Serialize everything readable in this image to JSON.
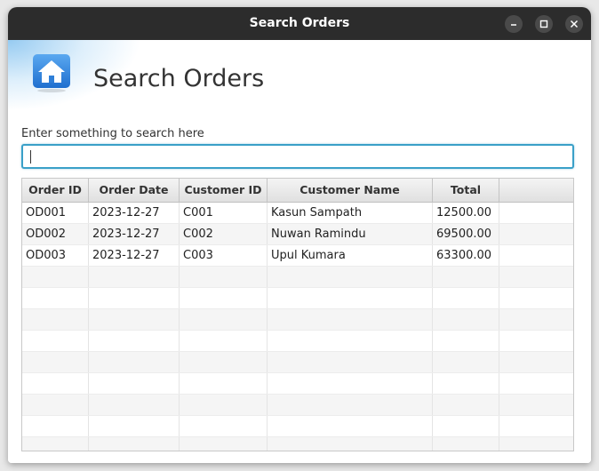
{
  "window": {
    "title": "Search Orders"
  },
  "header": {
    "title": "Search Orders",
    "icon": "home-icon"
  },
  "search": {
    "label": "Enter something to search here",
    "value": "",
    "placeholder": ""
  },
  "table": {
    "columns": [
      "Order ID",
      "Order Date",
      "Customer ID",
      "Customer Name",
      "Total",
      ""
    ],
    "rows": [
      [
        "OD001",
        "2023-12-27",
        "C001",
        "Kasun Sampath",
        "12500.00",
        ""
      ],
      [
        "OD002",
        "2023-12-27",
        "C002",
        "Nuwan Ramindu",
        "69500.00",
        ""
      ],
      [
        "OD003",
        "2023-12-27",
        "C003",
        "Upul Kumara",
        "63300.00",
        ""
      ]
    ]
  },
  "colors": {
    "accent": "#3aa0c8",
    "icon_blue": "#2f7fd8",
    "titlebar": "#2c2c2c"
  }
}
